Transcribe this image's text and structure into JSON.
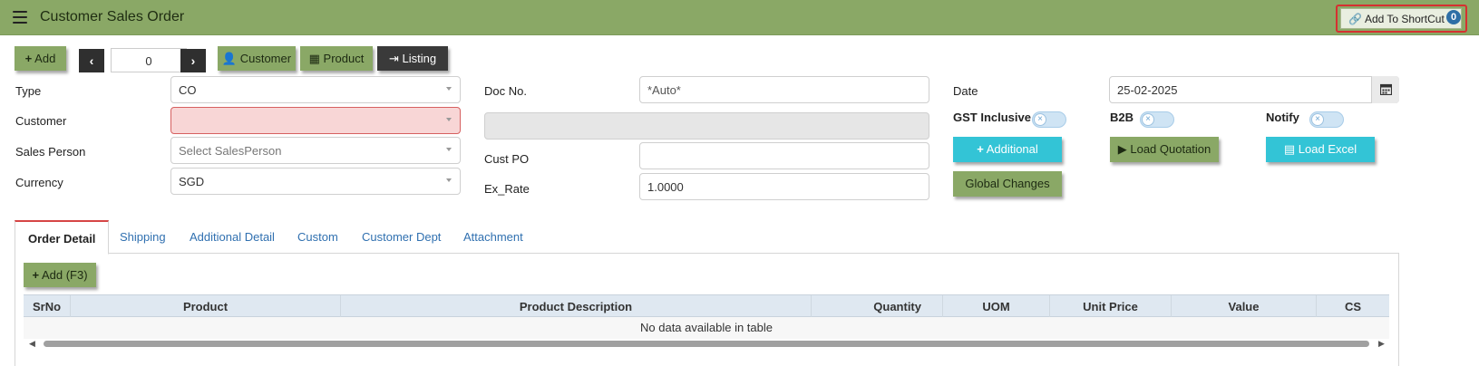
{
  "header": {
    "title": "Customer Sales Order",
    "shortcut_label": "Add To ShortCut",
    "shortcut_count": "0"
  },
  "toolbar": {
    "add_label": "Add",
    "record_value": "0",
    "customer_label": "Customer",
    "product_label": "Product",
    "listing_label": "Listing"
  },
  "form": {
    "type_label": "Type",
    "type_value": "CO",
    "customer_label": "Customer",
    "customer_value": "",
    "sales_person_label": "Sales Person",
    "sales_person_placeholder": "Select SalesPerson",
    "currency_label": "Currency",
    "currency_value": "SGD",
    "doc_no_label": "Doc No.",
    "doc_no_value": "*Auto*",
    "customer_name_value": "",
    "cust_po_label": "Cust PO",
    "cust_po_value": "",
    "ex_rate_label": "Ex_Rate",
    "ex_rate_value": "1.0000",
    "date_label": "Date",
    "date_value": "25-02-2025",
    "gst_label": "GST Inclusive",
    "b2b_label": "B2B",
    "notify_label": "Notify",
    "additional_label": "Additional",
    "load_quotation_label": "Load Quotation",
    "load_excel_label": "Load Excel",
    "global_changes_label": "Global Changes"
  },
  "tabs": [
    "Order Detail",
    "Shipping",
    "Additional Detail",
    "Custom",
    "Customer Dept",
    "Attachment"
  ],
  "detail": {
    "add_label": "Add (F3)",
    "columns": [
      "SrNo",
      "Product",
      "Product Description",
      "Quantity",
      "UOM",
      "Unit Price",
      "Value",
      "CS"
    ],
    "empty_text": "No data available in table"
  },
  "colors": {
    "header_green": "#8aa866",
    "accent_cyan": "#33c4d6",
    "error_red": "#d63030",
    "tab_link_blue": "#3070b0"
  },
  "icons": [
    "hamburger-icon",
    "link-icon",
    "plus-icon",
    "chevron-left-icon",
    "chevron-right-icon",
    "user-icon",
    "grid-icon",
    "sign-out-icon",
    "calendar-icon",
    "play-circle-icon",
    "excel-file-icon"
  ]
}
